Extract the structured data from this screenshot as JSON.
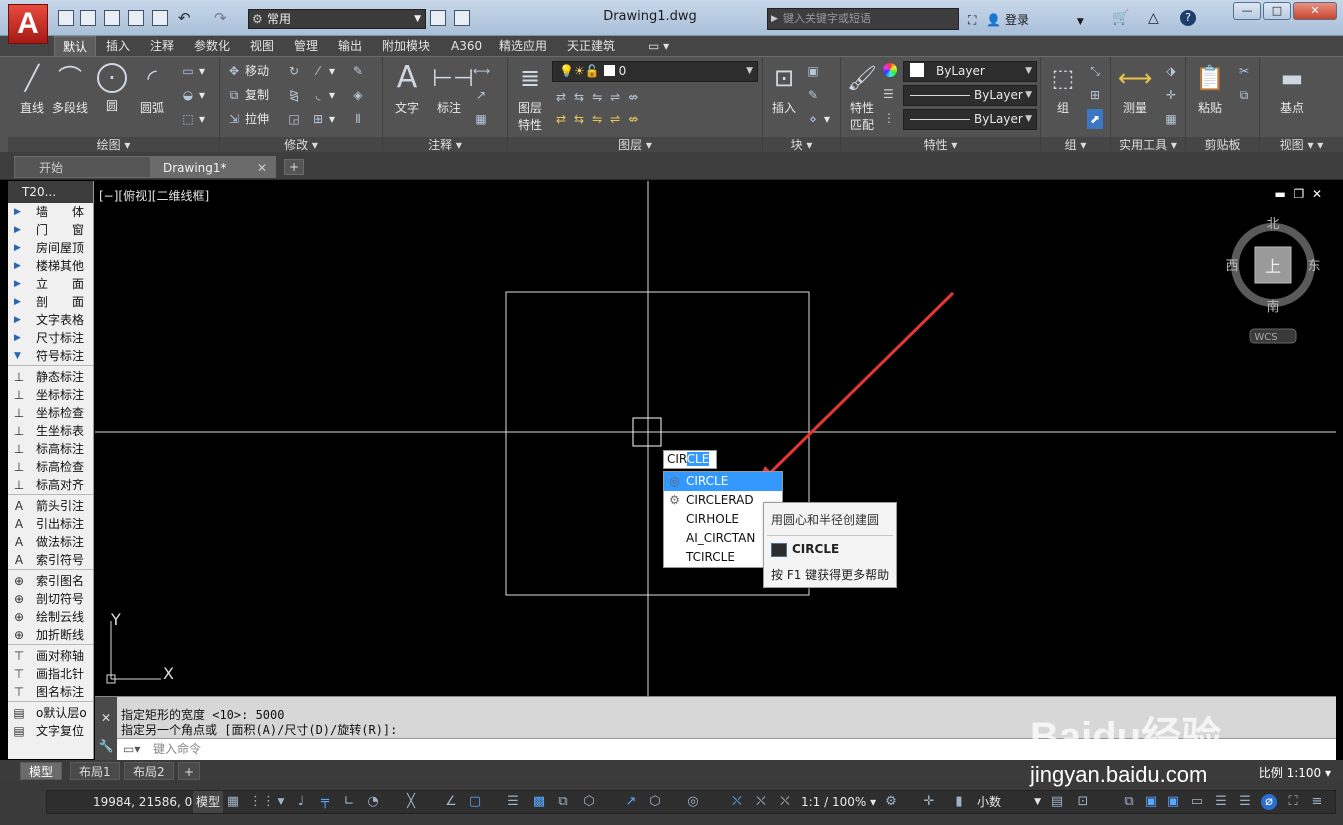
{
  "app": {
    "logo_letter": "A",
    "document_title": "Drawing1.dwg"
  },
  "titlebar": {
    "workspace": "常用",
    "search_placeholder": "键入关键字或短语",
    "login_label": "登录",
    "help_label": "?"
  },
  "ribbon_tabs": [
    "默认",
    "插入",
    "注释",
    "参数化",
    "视图",
    "管理",
    "输出",
    "附加模块",
    "A360",
    "精选应用",
    "天正建筑"
  ],
  "ribbon": {
    "draw": {
      "title": "绘图",
      "line": "直线",
      "polyline": "多段线",
      "circle": "圆",
      "arc": "圆弧"
    },
    "modify": {
      "title": "修改",
      "move": "移动",
      "copy": "复制",
      "stretch": "拉伸"
    },
    "annotation": {
      "title": "注释",
      "text": "文字",
      "dimension": "标注"
    },
    "layers": {
      "title": "图层",
      "layer_props_line1": "图层",
      "layer_props_line2": "特性",
      "current_layer": "0"
    },
    "block": {
      "title": "块",
      "insert": "插入"
    },
    "properties": {
      "title": "特性",
      "match_line1": "特性",
      "match_line2": "匹配",
      "color": "ByLayer",
      "linetype": "ByLayer",
      "lineweight": "ByLayer"
    },
    "groups": {
      "title": "组",
      "group": "组"
    },
    "utilities": {
      "title": "实用工具",
      "measure": "测量"
    },
    "clipboard": {
      "title": "剪贴板",
      "paste": "粘贴"
    },
    "view": {
      "title": "视图",
      "base": "基点"
    }
  },
  "doc_tabs": {
    "start": "开始",
    "drawing": "Drawing1*"
  },
  "palette": {
    "title": "T20...",
    "group1": [
      "墙　　体",
      "门　　窗",
      "房间屋顶",
      "楼梯其他",
      "立　　面",
      "剖　　面",
      "文字表格",
      "尺寸标注",
      "符号标注"
    ],
    "group2": [
      "静态标注",
      "坐标标注",
      "坐标检查",
      "生坐标表",
      "标高标注",
      "标高检查",
      "标高对齐"
    ],
    "group3": [
      "箭头引注",
      "引出标注",
      "做法标注",
      "索引符号"
    ],
    "group4": [
      "索引图名",
      "剖切符号",
      "绘制云线",
      "加折断线"
    ],
    "group5": [
      "画对称轴",
      "画指北针",
      "图名标注"
    ],
    "group6": [
      "o默认层o",
      "文字复位"
    ]
  },
  "viewport": {
    "label": "[−][俯视][二维线框]",
    "viewcube": {
      "north": "北",
      "south": "南",
      "east": "东",
      "west": "西",
      "top": "上",
      "wcs": "WCS"
    },
    "ucs": {
      "x": "X",
      "y": "Y"
    },
    "dynamic_input": {
      "typed": "CIR",
      "suggested": "CLE"
    },
    "autocomplete": [
      {
        "label": "CIRCLE",
        "icon": "circle-icon"
      },
      {
        "label": "CIRCLERAD",
        "icon": "gear-icon"
      },
      {
        "label": "CIRHOLE",
        "icon": ""
      },
      {
        "label": "AI_CIRCTAN",
        "icon": ""
      },
      {
        "label": "TCIRCLE",
        "icon": ""
      }
    ],
    "tooltip": {
      "desc": "用圆心和半径创建圆",
      "command": "CIRCLE",
      "help": "按 F1 键获得更多帮助"
    },
    "annotation_arrow_color": "#e63535"
  },
  "command": {
    "history": [
      "指定矩形的宽度 <10>: 5000",
      "指定另一个角点或 [面积(A)/尺寸(D)/旋转(R)]:"
    ],
    "placeholder": "键入命令"
  },
  "layout_tabs": [
    "模型",
    "布局1",
    "布局2"
  ],
  "status": {
    "coords": "19984, 21586, 0",
    "model": "模型",
    "scale": "1:1 / 100%",
    "units": "小数",
    "view_scale": "比例 1:100"
  },
  "watermark": {
    "brand": "Baidu经验",
    "url": "jingyan.baidu.com"
  }
}
